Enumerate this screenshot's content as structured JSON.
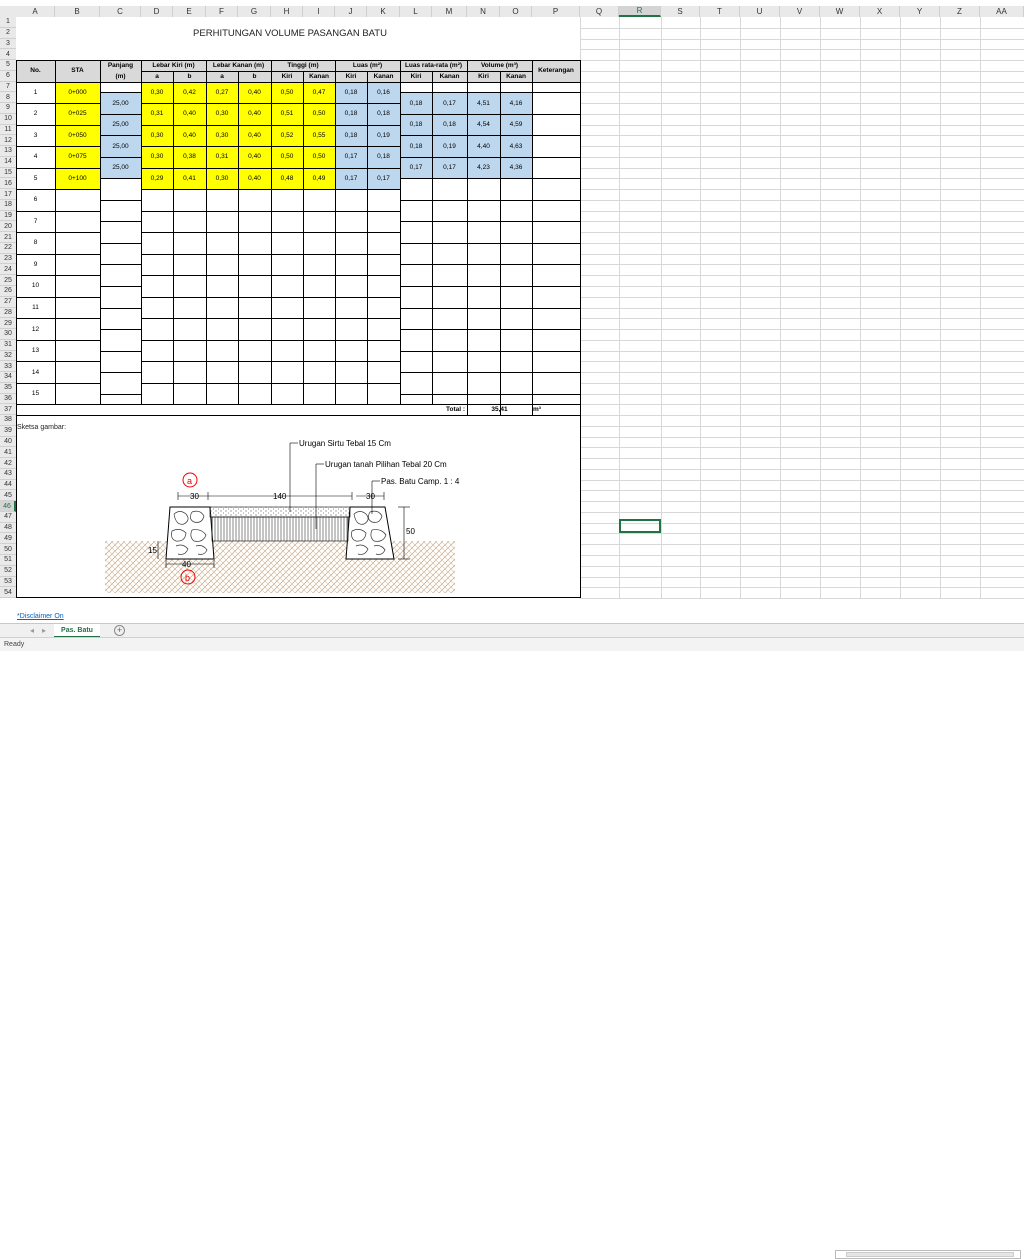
{
  "columns": [
    "A",
    "B",
    "C",
    "D",
    "E",
    "F",
    "G",
    "H",
    "I",
    "J",
    "K",
    "L",
    "M",
    "N",
    "O",
    "P",
    "Q",
    "R",
    "S",
    "T",
    "U",
    "V",
    "W",
    "X",
    "Y",
    "Z",
    "AA"
  ],
  "selected_column": "R",
  "selected_row": "46",
  "title": "PERHITUNGAN VOLUME PASANGAN BATU",
  "headers": {
    "no": "No.",
    "sta": "STA",
    "panjang": "Panjang",
    "panjang_unit": "(m)",
    "lebar_kiri": "Lebar Kiri (m)",
    "lebar_kanan": "Lebar Kanan (m)",
    "tinggi": "Tinggi (m)",
    "luas": "Luas (m²)",
    "luas_rata": "Luas rata-rata (m²)",
    "volume": "Volume (m³)",
    "keterangan": "Keterangan",
    "sub_a": "a",
    "sub_b": "b",
    "sub_kiri": "Kiri",
    "sub_kanan": "Kanan"
  },
  "stations": [
    {
      "no": "1",
      "sta": "0+000",
      "lka": "0,30",
      "lkb": "0,42",
      "lna": "0,27",
      "lnb": "0,40",
      "tki": "0,50",
      "tka": "0,47",
      "lski": "0,18",
      "lska": "0,16"
    },
    {
      "no": "2",
      "sta": "0+025",
      "lka": "0,31",
      "lkb": "0,40",
      "lna": "0,30",
      "lnb": "0,40",
      "tki": "0,51",
      "tka": "0,50",
      "lski": "0,18",
      "lska": "0,18"
    },
    {
      "no": "3",
      "sta": "0+050",
      "lka": "0,30",
      "lkb": "0,40",
      "lna": "0,30",
      "lnb": "0,40",
      "tki": "0,52",
      "tka": "0,55",
      "lski": "0,18",
      "lska": "0,19"
    },
    {
      "no": "4",
      "sta": "0+075",
      "lka": "0,30",
      "lkb": "0,38",
      "lna": "0,31",
      "lnb": "0,40",
      "tki": "0,50",
      "tka": "0,50",
      "lski": "0,17",
      "lska": "0,18"
    },
    {
      "no": "5",
      "sta": "0+100",
      "lka": "0,29",
      "lkb": "0,41",
      "lna": "0,30",
      "lnb": "0,40",
      "tki": "0,48",
      "tka": "0,49",
      "lski": "0,17",
      "lska": "0,17"
    }
  ],
  "segments": [
    {
      "panjang": "25,00",
      "lr_kiri": "0,18",
      "lr_kanan": "0,17",
      "vol_kiri": "4,51",
      "vol_kanan": "4,16"
    },
    {
      "panjang": "25,00",
      "lr_kiri": "0,18",
      "lr_kanan": "0,18",
      "vol_kiri": "4,54",
      "vol_kanan": "4,59"
    },
    {
      "panjang": "25,00",
      "lr_kiri": "0,18",
      "lr_kanan": "0,19",
      "vol_kiri": "4,40",
      "vol_kanan": "4,63"
    },
    {
      "panjang": "25,00",
      "lr_kiri": "0,17",
      "lr_kanan": "0,17",
      "vol_kiri": "4,23",
      "vol_kanan": "4,36"
    }
  ],
  "empty_rows": [
    "6",
    "7",
    "8",
    "9",
    "10",
    "11",
    "12",
    "13",
    "14",
    "15"
  ],
  "total_label": "Total :",
  "total_value": "35,41",
  "total_unit": "m³",
  "sketch_label": "Sketsa gambar:",
  "sketch": {
    "label_sirtu": "Urugan Sirtu Tebal 15 Cm",
    "label_tanah": "Urugan tanah Pilihan Tebal 20 Cm",
    "label_batu": "Pas. Batu Camp. 1 : 4",
    "dim_30_left": "30",
    "dim_140": "140",
    "dim_30_right": "30",
    "dim_50": "50",
    "dim_15": "15",
    "dim_40": "40",
    "marker_a": "a",
    "marker_b": "b"
  },
  "disclaimer": "*Disclaimer On",
  "sheet_tab": "Pas. Batu",
  "status": "Ready"
}
